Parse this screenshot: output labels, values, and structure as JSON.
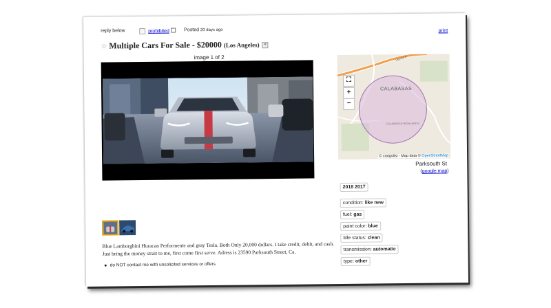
{
  "header": {
    "reply_label": "reply below",
    "prohibited_label": "prohibited",
    "posted_label": "Posted",
    "posted_time": "20 days ago",
    "print_label": "print"
  },
  "listing": {
    "title": "Multiple Cars For Sale - $20000",
    "location": "(Los Angeles)"
  },
  "gallery": {
    "image_counter": "image 1 of 2",
    "thumbnail_count": 2
  },
  "map": {
    "place_label": "CALABASAS",
    "road_label": "Ventura",
    "park_label": "CALABASAS HIGHLANDS",
    "zoom_in": "+",
    "zoom_out": "−",
    "attribution_prefix": "© craigslist - Map data ©",
    "attribution_link": "OpenStreetMap",
    "street": "Parksouth St",
    "google_map_link": "google map"
  },
  "attributes": {
    "year_models": "2018 2017",
    "items": [
      {
        "key": "condition:",
        "value": "like new"
      },
      {
        "key": "fuel:",
        "value": "gas"
      },
      {
        "key": "paint color:",
        "value": "blue"
      },
      {
        "key": "title status:",
        "value": "clean"
      },
      {
        "key": "transmission:",
        "value": "automatic"
      },
      {
        "key": "type:",
        "value": "other"
      }
    ]
  },
  "posting_body": "Blue Lamborghini Huracan Performente and gray Tesla. Both Only 20,000 dollars. I take credit, debit, and cash. Just bring the money strait to me, first come first serve. Adress is 23590 Parksouth Street, Ca.",
  "notices": [
    "do NOT contact me with unsolicited services or offers"
  ],
  "colors": {
    "link": "#0000cc",
    "map_circle": "#a070b0",
    "thumb_selected": "#e6a100",
    "road_orange": "#f0a04b"
  }
}
